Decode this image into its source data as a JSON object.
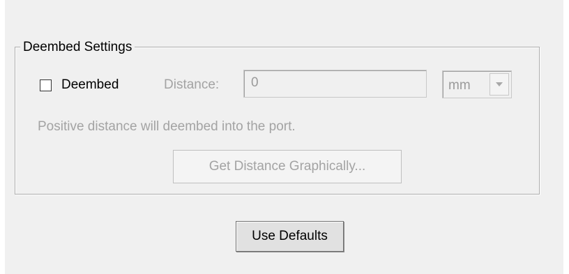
{
  "group": {
    "title": "Deembed Settings"
  },
  "deembed_checkbox": {
    "label": "Deembed",
    "checked": false
  },
  "distance": {
    "label": "Distance:",
    "value": "0",
    "enabled": false
  },
  "unit_select": {
    "value": "mm",
    "icon": "chevron-down-icon",
    "enabled": false
  },
  "hint": "Positive distance will deembed into the port.",
  "buttons": {
    "get_distance_graphically": "Get Distance Graphically...",
    "use_defaults": "Use Defaults"
  },
  "colors": {
    "dialog_background": "#f0f0f0",
    "disabled_text": "#a3a3a3",
    "enabled_text": "#000000"
  }
}
